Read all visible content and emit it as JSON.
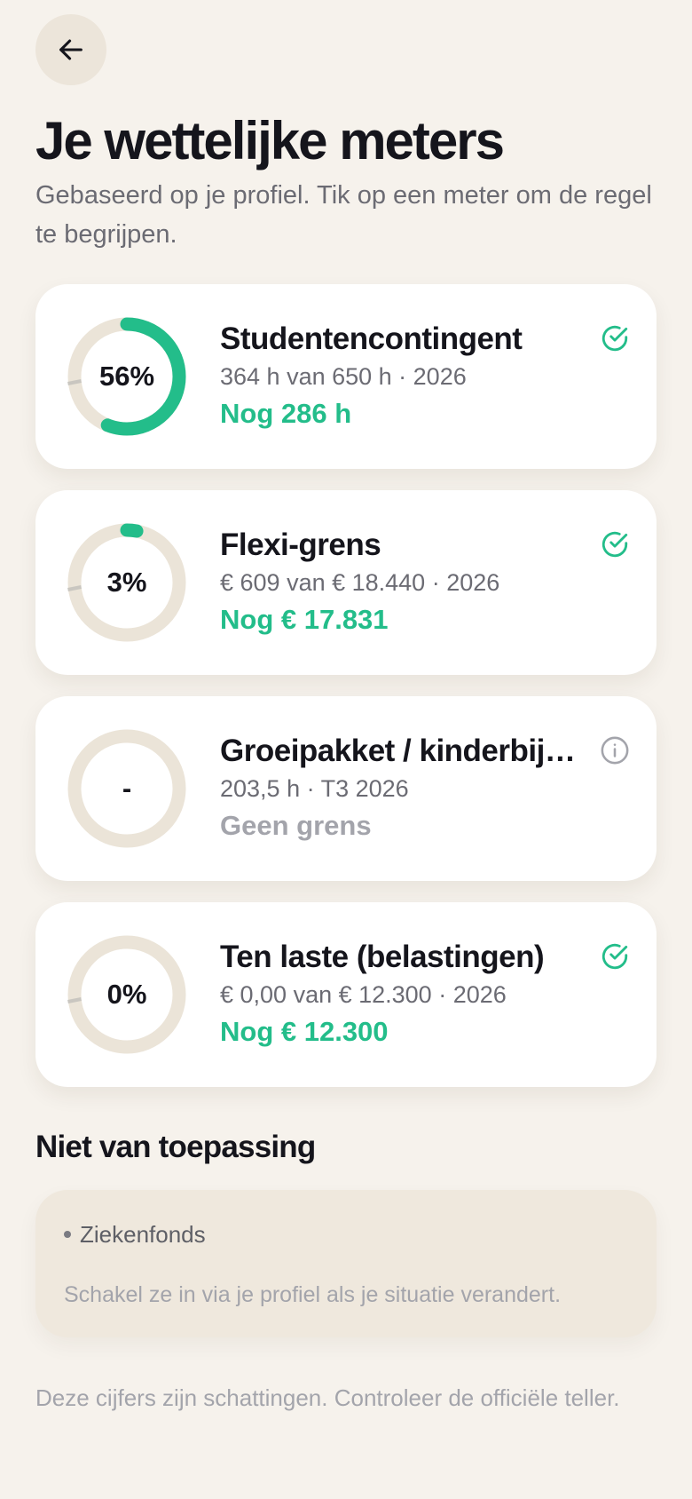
{
  "header": {
    "back_icon": "arrow-left-icon",
    "title": "Je wettelijke meters",
    "subtitle": "Gebaseerd op je profiel. Tik op een meter om de regel te begrijpen."
  },
  "meters": [
    {
      "gauge_label": "56%",
      "progress": 0.56,
      "title": "Studentencontingent",
      "detail": "364 h van 650 h · 2026",
      "remaining": "Nog 286 h",
      "status_icon": "check-circle-icon",
      "status_color": "#23bd8a"
    },
    {
      "gauge_label": "3%",
      "progress": 0.03,
      "title": "Flexi-grens",
      "detail": "€ 609 van € 18.440 · 2026",
      "remaining": "Nog € 17.831",
      "status_icon": "check-circle-icon",
      "status_color": "#23bd8a"
    },
    {
      "gauge_label": "-",
      "progress": null,
      "title": "Groeipakket / kinderbijslag",
      "detail": "203,5 h · T3 2026",
      "remaining": "Geen grens",
      "status_icon": "info-circle-icon",
      "status_color": "#a3a4ab"
    },
    {
      "gauge_label": "0%",
      "progress": 0.0,
      "title": "Ten laste (belastingen)",
      "detail": "€ 0,00 van € 12.300 · 2026",
      "remaining": "Nog € 12.300",
      "status_icon": "check-circle-icon",
      "status_color": "#23bd8a"
    }
  ],
  "not_applicable": {
    "title": "Niet van toepassing",
    "items": [
      "Ziekenfonds"
    ],
    "note": "Schakel ze in via je profiel als je situatie verandert."
  },
  "footer_note": "Deze cijfers zijn schattingen. Controleer de officiële teller.",
  "colors": {
    "accent": "#23bd8a",
    "track": "#ebe4d8",
    "muted": "#a3a4ab",
    "background": "#f6f2ec"
  }
}
